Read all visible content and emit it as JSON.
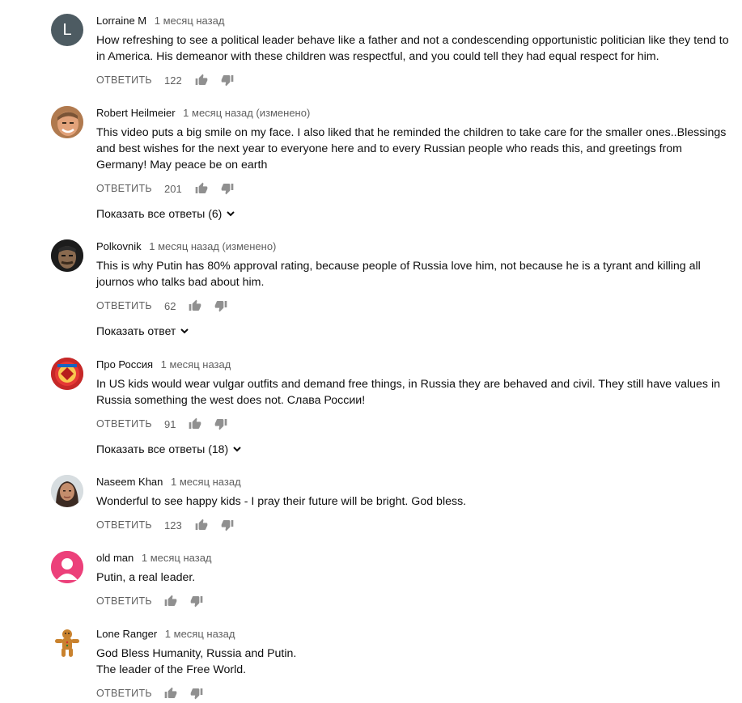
{
  "comments": [
    {
      "author": "Lorraine M",
      "time": "1 месяц назад",
      "text": "How refreshing to see a political leader behave like a father and not a condescending opportunistic politician like they tend to in America. His demeanor with these children was respectful, and you could tell they had equal respect for him.",
      "reply_label": "ОТВЕТИТЬ",
      "likes": "122",
      "avatar_letter": "L",
      "avatar_color": "#4d5b62"
    },
    {
      "author": "Robert Heilmeier",
      "time": "1 месяц назад (изменено)",
      "text": "This video puts a big smile on my face. I also liked that he reminded the children to take care for the smaller ones..Blessings and best wishes for the next year to everyone here and to every Russian people who reads this, and greetings from Germany! May peace be on earth",
      "reply_label": "ОТВЕТИТЬ",
      "likes": "201",
      "show_replies": "Показать все ответы (6)"
    },
    {
      "author": "Polkovnik",
      "time": "1 месяц назад (изменено)",
      "text": "This is why Putin has 80% approval rating, because people of Russia love him, not because he is a tyrant and killing all journos who talks bad about him.",
      "reply_label": "ОТВЕТИТЬ",
      "likes": "62",
      "show_replies": "Показать ответ"
    },
    {
      "author": "Про Россия",
      "time": "1 месяц назад",
      "text": "In US kids would wear vulgar outfits and demand free things, in Russia they are behaved and civil. They still have values in Russia something the west does not. Слава России!",
      "reply_label": "ОТВЕТИТЬ",
      "likes": "91",
      "show_replies": "Показать все ответы (18)"
    },
    {
      "author": "Naseem Khan",
      "time": "1 месяц назад",
      "text": "Wonderful to see happy kids - I pray their future will be bright.  God bless.",
      "reply_label": "ОТВЕТИТЬ",
      "likes": "123"
    },
    {
      "author": "old man",
      "time": "1 месяц назад",
      "text": "Putin, a real leader.",
      "reply_label": "ОТВЕТИТЬ",
      "likes": "",
      "avatar_color": "#ec407a"
    },
    {
      "author": "Lone Ranger",
      "time": "1 месяц назад",
      "text": "God Bless Humanity, Russia and Putin.\nThe leader of the Free World.",
      "reply_label": "ОТВЕТИТЬ",
      "likes": ""
    }
  ],
  "icons": {
    "like": "thumb-up-icon",
    "dislike": "thumb-down-icon",
    "expand": "chevron-down-icon"
  }
}
